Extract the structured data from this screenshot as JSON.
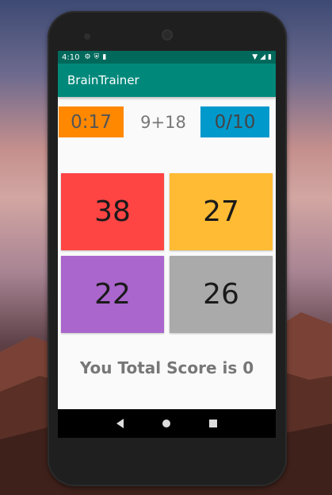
{
  "status_bar": {
    "time": "4:10",
    "icons": [
      "gear-icon",
      "shield-icon",
      "sim-card-icon"
    ],
    "right_icons": [
      "wifi-icon",
      "signal-icon",
      "battery-icon"
    ]
  },
  "app_bar": {
    "title": "BrainTrainer"
  },
  "game": {
    "timer": "0:17",
    "question": "9+18",
    "score": "0/10",
    "answers": [
      "38",
      "27",
      "22",
      "26"
    ],
    "result": "You Total Score is 0"
  },
  "colors": {
    "status_bar": "#00695c",
    "app_bar": "#00897b",
    "timer_bg": "#ff8800",
    "score_bg": "#0099cc",
    "answer_0": "#ff4444",
    "answer_1": "#ffbb33",
    "answer_2": "#aa66cc",
    "answer_3": "#aaaaaa"
  },
  "nav_bar": [
    "back-icon",
    "home-icon",
    "recents-icon"
  ]
}
